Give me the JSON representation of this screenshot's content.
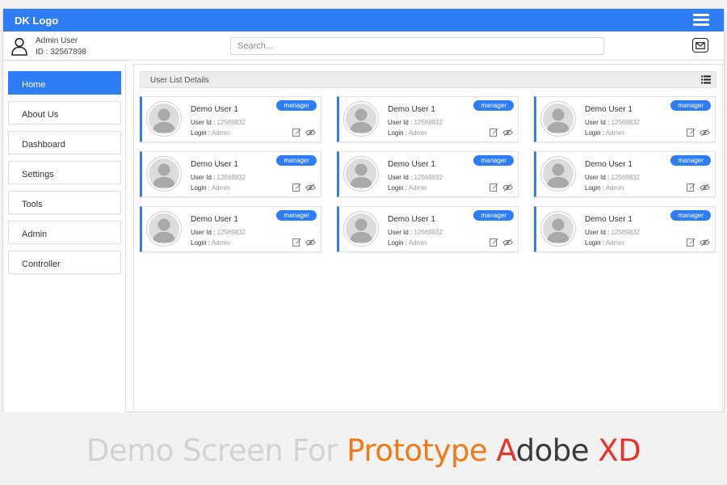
{
  "header": {
    "logo": "DK Logo",
    "user_name": "Admin User",
    "user_id": "ID : 32567898",
    "search_placeholder": "Search..."
  },
  "sidebar": {
    "items": [
      {
        "label": "Home",
        "active": true
      },
      {
        "label": "About Us"
      },
      {
        "label": "Dashboard"
      },
      {
        "label": "Settings"
      },
      {
        "label": "Tools"
      },
      {
        "label": "Admin"
      },
      {
        "label": "Controller"
      }
    ]
  },
  "main": {
    "list_title": "User List Details",
    "cards": [
      {
        "name": "Demo User 1",
        "role": "manager",
        "user_id_label": "User Id :",
        "user_id": "12569832",
        "login_label": "Login :",
        "login": "Admin"
      },
      {
        "name": "Demo User 1",
        "role": "manager",
        "user_id_label": "User Id :",
        "user_id": "12569832",
        "login_label": "Login :",
        "login": "Admin"
      },
      {
        "name": "Demo User 1",
        "role": "manager",
        "user_id_label": "User Id :",
        "user_id": "12569832",
        "login_label": "Login :",
        "login": "Admin"
      },
      {
        "name": "Demo User 1",
        "role": "manager",
        "user_id_label": "User Id :",
        "user_id": "12569832",
        "login_label": "Login :",
        "login": "Admin"
      },
      {
        "name": "Demo User 1",
        "role": "manager",
        "user_id_label": "User Id :",
        "user_id": "12569832",
        "login_label": "Login :",
        "login": "Admin"
      },
      {
        "name": "Demo User 1",
        "role": "manager",
        "user_id_label": "User Id :",
        "user_id": "12569832",
        "login_label": "Login :",
        "login": "Admin"
      },
      {
        "name": "Demo User 1",
        "role": "manager",
        "user_id_label": "User Id :",
        "user_id": "12569832",
        "login_label": "Login :",
        "login": "Admin"
      },
      {
        "name": "Demo User 1",
        "role": "manager",
        "user_id_label": "User Id :",
        "user_id": "12569832",
        "login_label": "Login :",
        "login": "Admin"
      },
      {
        "name": "Demo User 1",
        "role": "manager",
        "user_id_label": "User Id :",
        "user_id": "12569832",
        "login_label": "Login :",
        "login": "Admin"
      }
    ]
  },
  "footer": {
    "part1": "Demo Screen For ",
    "part2": "Prototype ",
    "part3": "A",
    "part4": "dobe ",
    "part5": "XD"
  },
  "icons": {
    "menu": "hamburger-icon",
    "user": "user-icon",
    "mail": "mail-icon",
    "list": "list-icon",
    "avatar": "avatar-icon",
    "edit": "edit-icon",
    "view": "eye-icon"
  },
  "colors": {
    "accent": "#2f7df6",
    "footer_gray": "#d2d2d2",
    "footer_orange": "#f07a1a",
    "footer_red": "#e8312a",
    "footer_dark": "#3a3a3a"
  }
}
